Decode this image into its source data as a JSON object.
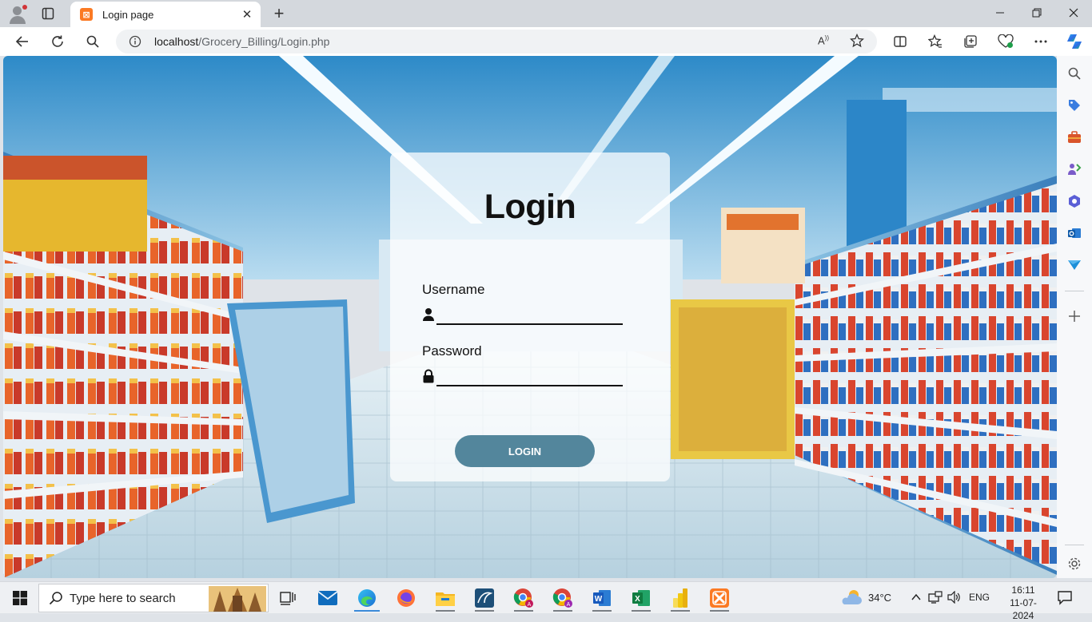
{
  "browser": {
    "tab_title": "Login page",
    "tab_favicon_glyph": "⊠",
    "url_host": "localhost",
    "url_path": "/Grocery_Billing/Login.php"
  },
  "page": {
    "title": "Login",
    "username_label": "Username",
    "password_label": "Password",
    "username_value": "",
    "password_value": "",
    "login_button": "LOGIN",
    "card_color": "#ffffff",
    "button_color": "#53869c"
  },
  "taskbar": {
    "search_placeholder": "Type here to search",
    "temperature": "34°C",
    "language": "ENG",
    "time": "16:11",
    "date": "11-07-2024",
    "apps": [
      "task-view-icon",
      "mail-icon",
      "edge-icon",
      "firefox-icon",
      "file-explorer-icon",
      "mysql-workbench-icon",
      "chrome-profile-a-icon",
      "chrome-profile-b-icon",
      "word-icon",
      "excel-icon",
      "power-bi-icon",
      "xampp-icon"
    ]
  },
  "sidebar_icons": [
    "search-icon",
    "shopping-tag-icon",
    "tools-icon",
    "games-icon",
    "copilot-hub-icon",
    "outlook-icon",
    "drop-icon",
    "add-icon",
    "settings-icon"
  ]
}
